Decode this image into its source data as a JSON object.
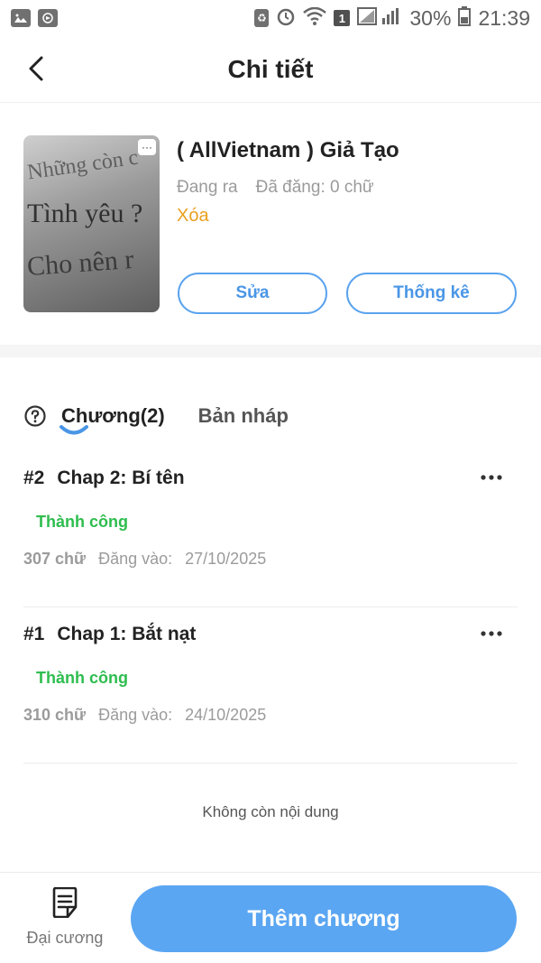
{
  "status_bar": {
    "battery": "30%",
    "time": "21:39",
    "sim_badge": "1"
  },
  "header": {
    "title": "Chi tiết"
  },
  "book": {
    "title": "( AllVietnam ) Giả Tạo",
    "status": "Đang ra",
    "published": "Đã đăng: 0 chữ",
    "delete_label": "Xóa",
    "edit_label": "Sửa",
    "stats_label": "Thống kê",
    "cover_text": [
      "Những còn c",
      "Tình yêu ?",
      "Cho nên r"
    ]
  },
  "tabs": {
    "chapters_label": "Chương(2)",
    "drafts_label": "Bản nháp"
  },
  "chapters": [
    {
      "number": "#2",
      "title": "Chap 2: Bí tên",
      "status": "Thành công",
      "word_count": "307 chữ",
      "posted_label": "Đăng vào:",
      "posted_date": "27/10/2025"
    },
    {
      "number": "#1",
      "title": "Chap 1: Bắt nạt",
      "status": "Thành công",
      "word_count": "310 chữ",
      "posted_label": "Đăng vào:",
      "posted_date": "24/10/2025"
    }
  ],
  "end_text": "Không còn nội dung",
  "bottom_bar": {
    "outline_label": "Đại cương",
    "add_chapter_label": "Thêm chương"
  },
  "colors": {
    "accent_blue": "#5aa6f2",
    "success_green": "#2ebd4e",
    "warning_orange": "#e8a020"
  }
}
